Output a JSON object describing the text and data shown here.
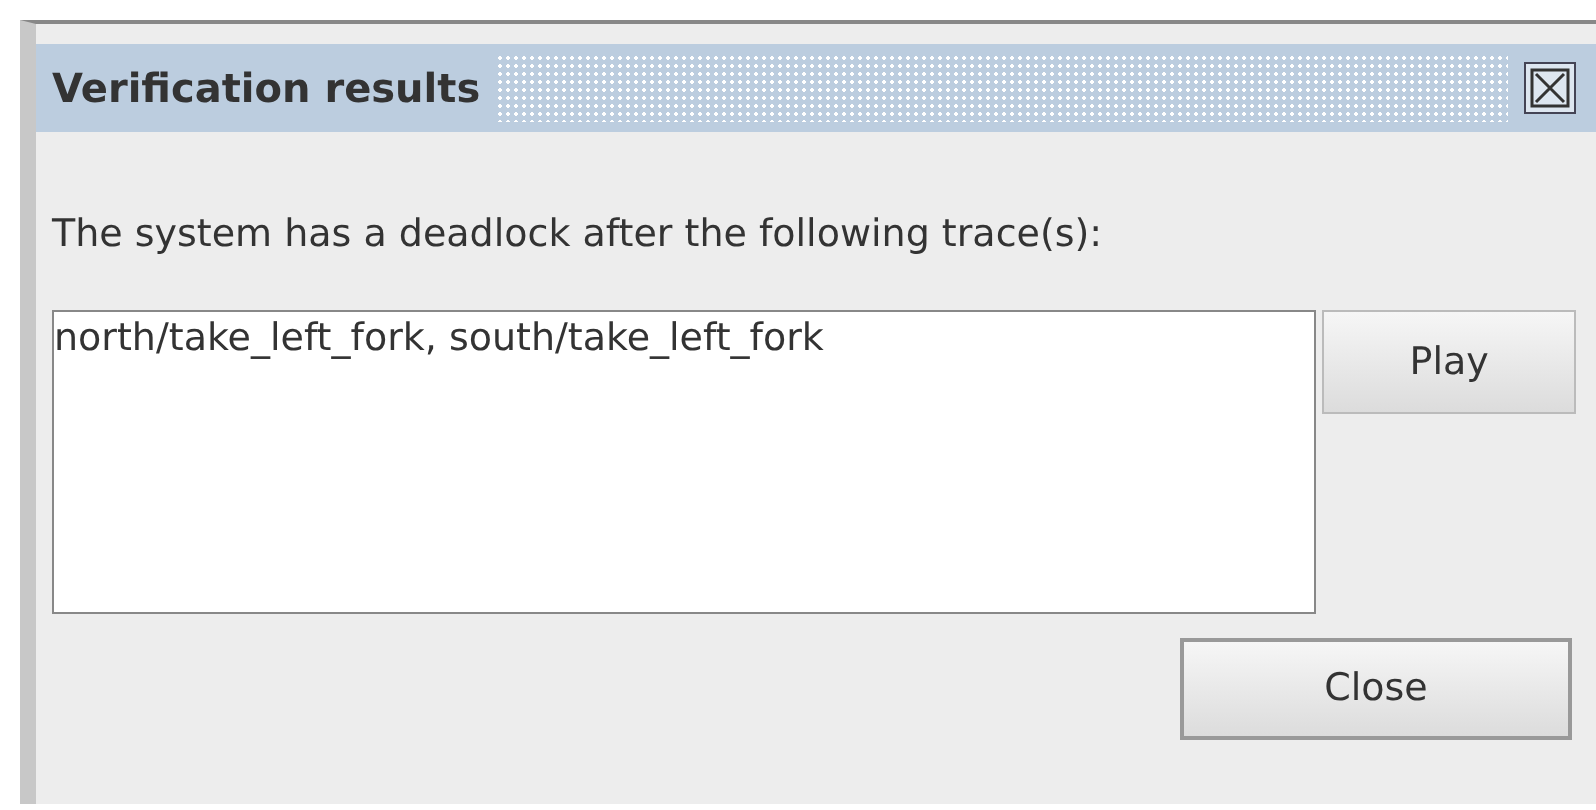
{
  "window": {
    "title": "Verification results"
  },
  "message": "The system has a deadlock after the following trace(s):",
  "traces": [
    "north/take_left_fork, south/take_left_fork"
  ],
  "buttons": {
    "play": "Play",
    "close": "Close"
  }
}
